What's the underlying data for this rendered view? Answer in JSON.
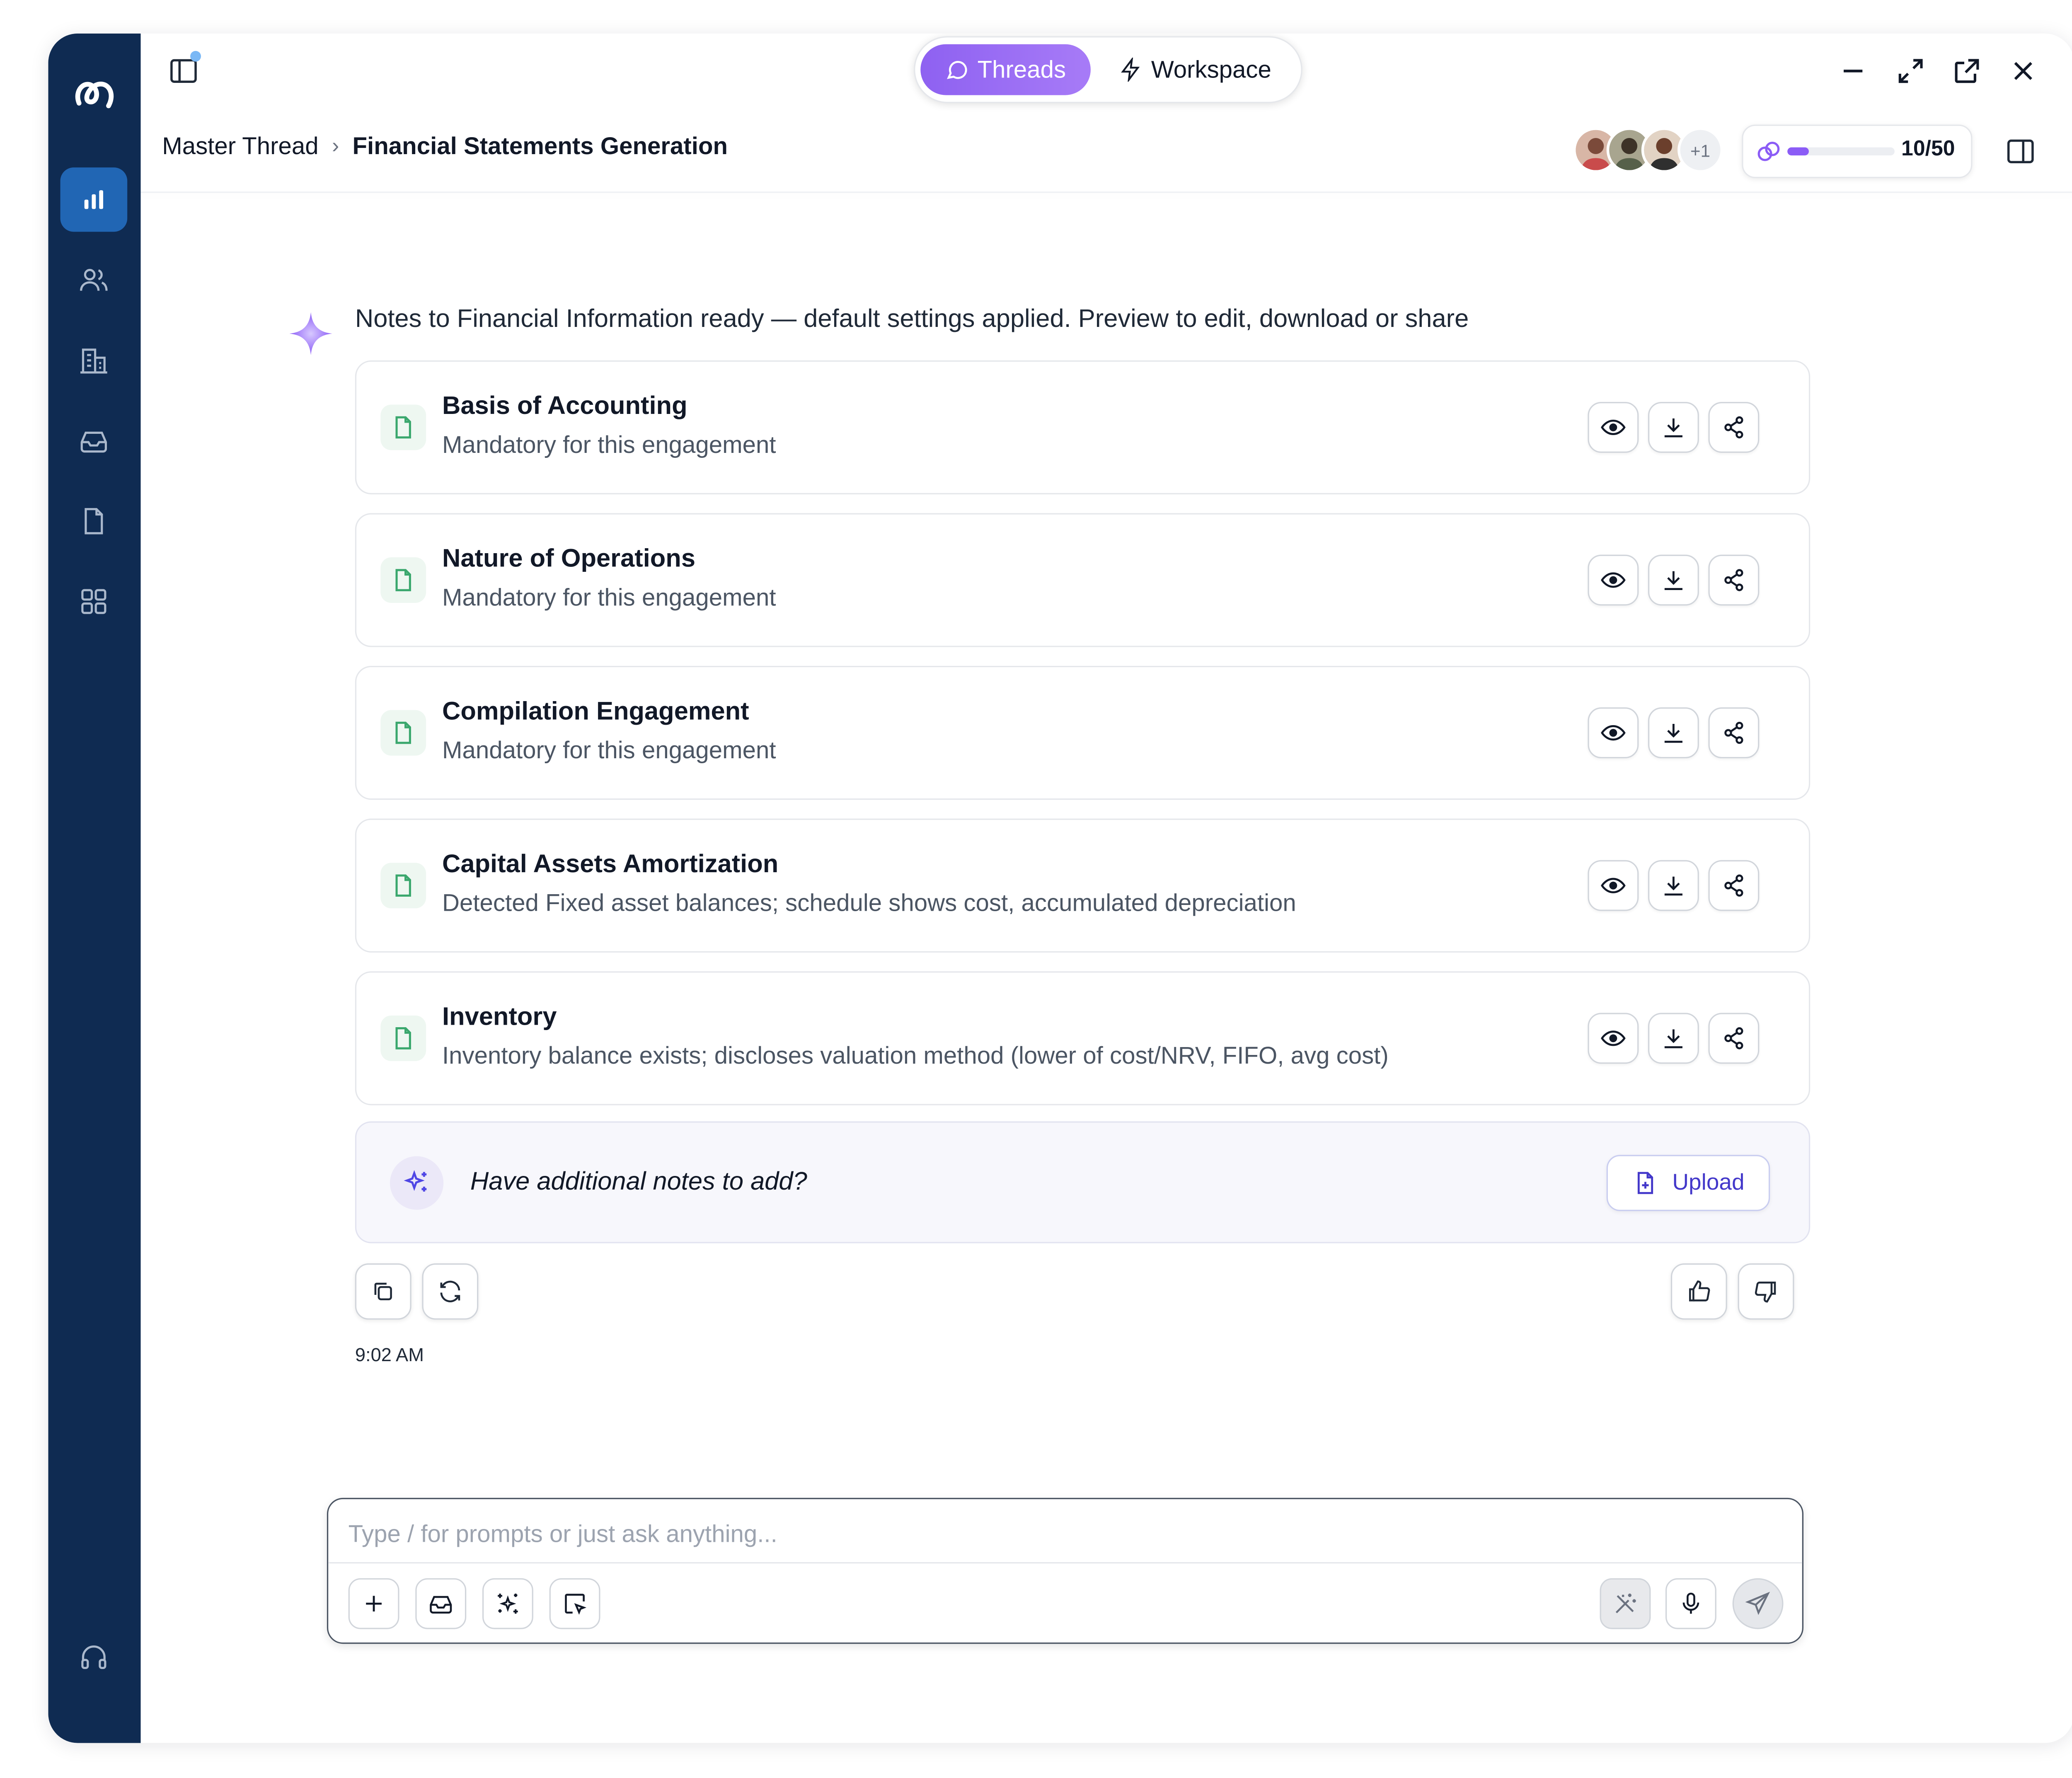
{
  "topbar": {
    "tabs": [
      {
        "label": "Threads",
        "icon": "chat-icon",
        "active": true
      },
      {
        "label": "Workspace",
        "icon": "lightning-icon",
        "active": false
      }
    ]
  },
  "breadcrumbs": {
    "parent": "Master Thread",
    "separator": "›",
    "current": "Financial Statements Generation"
  },
  "collaborators": {
    "extra_count": "+1"
  },
  "credits": {
    "label": "10/50",
    "used": 10,
    "total": 50
  },
  "sidebar": {
    "items": [
      {
        "icon": "chart-bar-icon",
        "active": true
      },
      {
        "icon": "users-icon",
        "active": false
      },
      {
        "icon": "building-icon",
        "active": false
      },
      {
        "icon": "inbox-icon",
        "active": false
      },
      {
        "icon": "document-icon",
        "active": false
      },
      {
        "icon": "apps-grid-icon",
        "active": false
      },
      {
        "icon": "headset-icon",
        "active": false
      }
    ]
  },
  "message": {
    "intro": "Notes to Financial Information ready — default settings applied. Preview to edit, download or share",
    "notes": [
      {
        "title": "Basis of Accounting",
        "subtitle": "Mandatory for this engagement"
      },
      {
        "title": "Nature of Operations",
        "subtitle": "Mandatory for this engagement"
      },
      {
        "title": "Compilation Engagement",
        "subtitle": "Mandatory for this engagement"
      },
      {
        "title": "Capital Assets Amortization",
        "subtitle": "Detected Fixed asset balances; schedule shows cost, accumulated depreciation"
      },
      {
        "title": "Inventory",
        "subtitle": "Inventory balance exists; discloses valuation method (lower of cost/NRV, FIFO, avg cost)"
      }
    ],
    "add_notes": {
      "prompt": "Have additional notes to add?",
      "upload_label": "Upload"
    },
    "timestamp": "9:02 AM"
  },
  "composer": {
    "placeholder": "Type / for prompts or just ask anything..."
  },
  "colors": {
    "sidebar_bg": "#0f2b52",
    "sidebar_active": "#2166b4",
    "accent_purple": "#8b5cf6",
    "file_icon_green": "#3aa76d"
  }
}
